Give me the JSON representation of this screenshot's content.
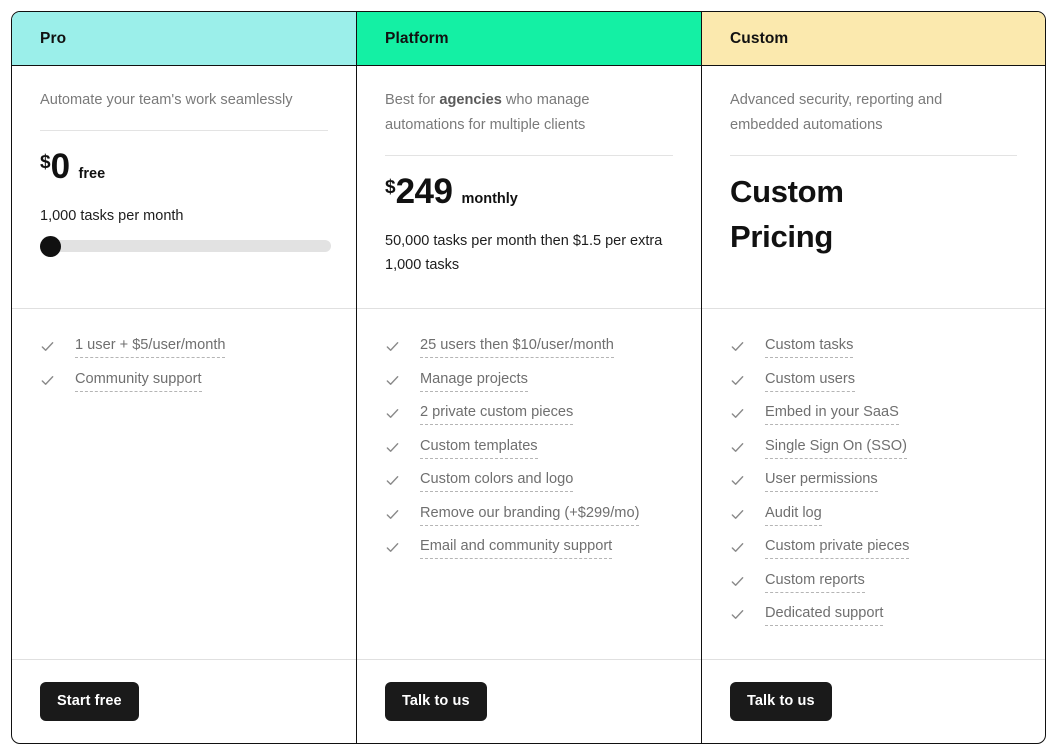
{
  "card": {
    "columns": [
      {
        "name": "Pro",
        "header_bg": "#9BEFEA",
        "tagline_prefix": "Automate your team's work seamlessly",
        "tagline_bold": "",
        "tagline_suffix": "",
        "currency": "$",
        "amount": "0",
        "period": "free",
        "custom_price": "",
        "tasks_note": "1,000 tasks per month",
        "has_slider": true,
        "slider_value": "1,000",
        "features": [
          "1 user + $5/user/month",
          "Community support"
        ],
        "cta_label": "Start free"
      },
      {
        "name": "Platform",
        "header_bg": "#14F0A4",
        "tagline_prefix": "Best for ",
        "tagline_bold": "agencies",
        "tagline_suffix": " who manage automations for multiple clients",
        "currency": "$",
        "amount": "249",
        "period": "monthly",
        "custom_price": "",
        "tasks_note": "50,000 tasks per month then $1.5 per extra 1,000 tasks",
        "has_slider": false,
        "slider_value": "",
        "features": [
          "25 users then $10/user/month",
          "Manage projects",
          "2 private custom pieces",
          "Custom templates",
          "Custom colors and logo",
          "Remove our branding (+$299/mo)",
          "Email and community support"
        ],
        "cta_label": "Talk to us"
      },
      {
        "name": "Custom",
        "header_bg": "#FBE9AE",
        "tagline_prefix": "Advanced security, reporting and embedded automations",
        "tagline_bold": "",
        "tagline_suffix": "",
        "currency": "",
        "amount": "",
        "period": "",
        "custom_price": "Custom Pricing",
        "tasks_note": "",
        "has_slider": false,
        "slider_value": "",
        "features": [
          "Custom tasks",
          "Custom users",
          "Embed in your SaaS",
          "Single Sign On (SSO)",
          "User permissions",
          "Audit log",
          "Custom private pieces",
          "Custom reports",
          "Dedicated support"
        ],
        "cta_label": "Talk to us"
      }
    ],
    "icons": {
      "check": "check-icon"
    },
    "colors": {
      "border": "#111111",
      "divider": "#e0e0e0",
      "muted_text": "#6f6f6f",
      "button_bg": "#1a1a1a",
      "button_text": "#ffffff",
      "slider_track": "#e2e2e2",
      "slider_thumb": "#111111"
    }
  }
}
